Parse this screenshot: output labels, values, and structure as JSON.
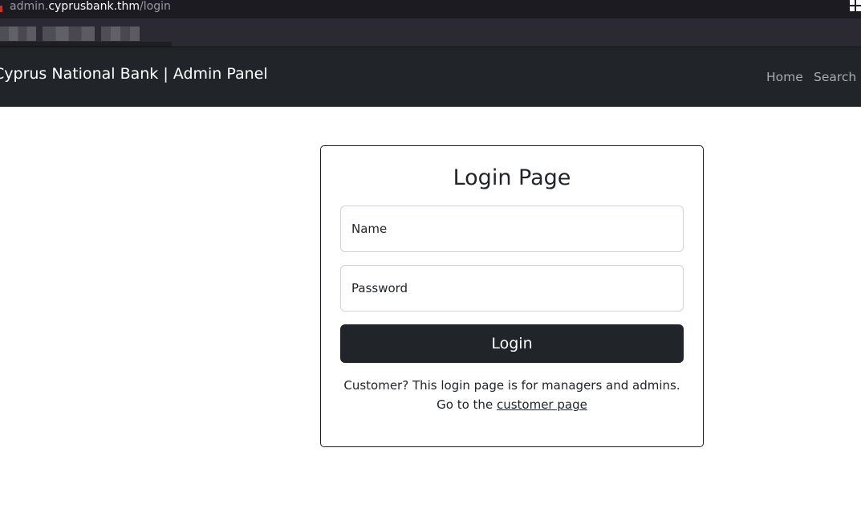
{
  "browser": {
    "url_host_prefix": "admin.",
    "url_host": "cyprusbank.thm",
    "url_path": "/login"
  },
  "navbar": {
    "brand": "Cyprus National Bank | Admin Panel",
    "links": [
      {
        "label": "Home"
      },
      {
        "label": "Search"
      }
    ]
  },
  "login": {
    "title": "Login Page",
    "name_placeholder": "Name",
    "password_placeholder": "Password",
    "button_label": "Login",
    "note_line1": "Customer? This login page is for managers and admins.",
    "note_line2_prefix": "Go to the",
    "customer_link_label": "customer page"
  }
}
